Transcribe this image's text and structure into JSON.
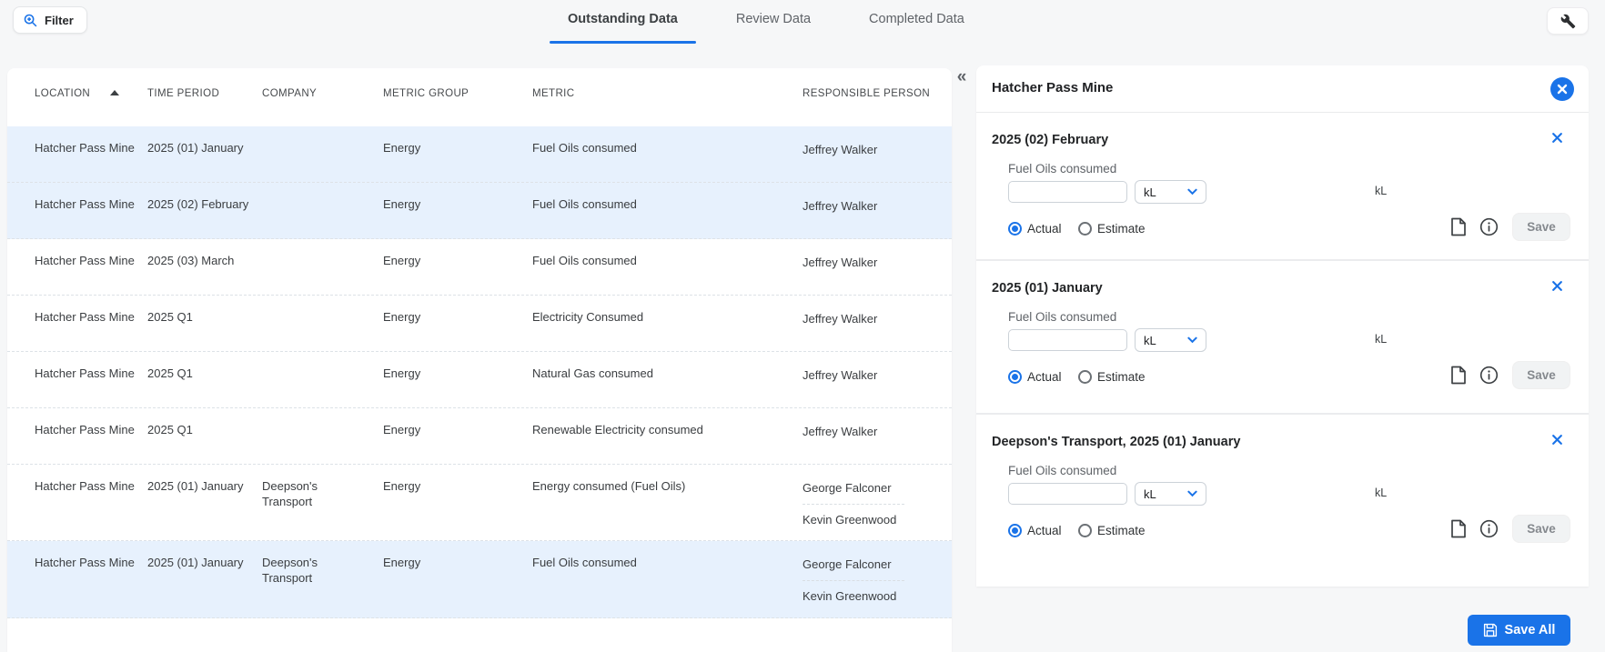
{
  "toolbar": {
    "filter_label": "Filter"
  },
  "tabs": [
    {
      "label": "Outstanding Data",
      "active": true
    },
    {
      "label": "Review Data",
      "active": false
    },
    {
      "label": "Completed Data",
      "active": false
    }
  ],
  "table": {
    "columns": [
      "LOCATION",
      "TIME PERIOD",
      "COMPANY",
      "METRIC GROUP",
      "METRIC",
      "RESPONSIBLE PERSON"
    ],
    "rows": [
      {
        "location": "Hatcher Pass Mine",
        "time_period": "2025 (01) January",
        "company": "",
        "metric_group": "Energy",
        "metric": "Fuel Oils consumed",
        "responsible": [
          "Jeffrey Walker"
        ],
        "highlighted": true
      },
      {
        "location": "Hatcher Pass Mine",
        "time_period": "2025 (02) February",
        "company": "",
        "metric_group": "Energy",
        "metric": "Fuel Oils consumed",
        "responsible": [
          "Jeffrey Walker"
        ],
        "highlighted": true
      },
      {
        "location": "Hatcher Pass Mine",
        "time_period": "2025 (03) March",
        "company": "",
        "metric_group": "Energy",
        "metric": "Fuel Oils consumed",
        "responsible": [
          "Jeffrey Walker"
        ],
        "highlighted": false
      },
      {
        "location": "Hatcher Pass Mine",
        "time_period": "2025 Q1",
        "company": "",
        "metric_group": "Energy",
        "metric": "Electricity Consumed",
        "responsible": [
          "Jeffrey Walker"
        ],
        "highlighted": false
      },
      {
        "location": "Hatcher Pass Mine",
        "time_period": "2025 Q1",
        "company": "",
        "metric_group": "Energy",
        "metric": "Natural Gas consumed",
        "responsible": [
          "Jeffrey Walker"
        ],
        "highlighted": false
      },
      {
        "location": "Hatcher Pass Mine",
        "time_period": "2025 Q1",
        "company": "",
        "metric_group": "Energy",
        "metric": "Renewable Electricity consumed",
        "responsible": [
          "Jeffrey Walker"
        ],
        "highlighted": false
      },
      {
        "location": "Hatcher Pass Mine",
        "time_period": "2025 (01) January",
        "company": "Deepson's Transport",
        "metric_group": "Energy",
        "metric": "Energy consumed (Fuel Oils)",
        "responsible": [
          "George Falconer",
          "Kevin Greenwood"
        ],
        "highlighted": false
      },
      {
        "location": "Hatcher Pass Mine",
        "time_period": "2025 (01) January",
        "company": "Deepson's Transport",
        "metric_group": "Energy",
        "metric": "Fuel Oils consumed",
        "responsible": [
          "George Falconer",
          "Kevin Greenwood"
        ],
        "highlighted": true
      }
    ]
  },
  "panel": {
    "title": "Hatcher Pass Mine",
    "sections": [
      {
        "title": "2025 (02) February",
        "metric_label": "Fuel Oils consumed",
        "input_value": "",
        "unit_select_value": "kL",
        "unit_label": "kL",
        "radio_actual_label": "Actual",
        "radio_estimate_label": "Estimate",
        "actual_selected": true,
        "save_label": "Save"
      },
      {
        "title": "2025 (01) January",
        "metric_label": "Fuel Oils consumed",
        "input_value": "",
        "unit_select_value": "kL",
        "unit_label": "kL",
        "radio_actual_label": "Actual",
        "radio_estimate_label": "Estimate",
        "actual_selected": true,
        "save_label": "Save"
      },
      {
        "title": "Deepson's Transport, 2025 (01) January",
        "metric_label": "Fuel Oils consumed",
        "input_value": "",
        "unit_select_value": "kL",
        "unit_label": "kL",
        "radio_actual_label": "Actual",
        "radio_estimate_label": "Estimate",
        "actual_selected": true,
        "save_label": "Save"
      }
    ],
    "save_all_label": "Save All"
  },
  "colors": {
    "accent": "#1a73e8",
    "row_highlight": "#e7f1fd",
    "page_background": "#f6f7f8"
  }
}
